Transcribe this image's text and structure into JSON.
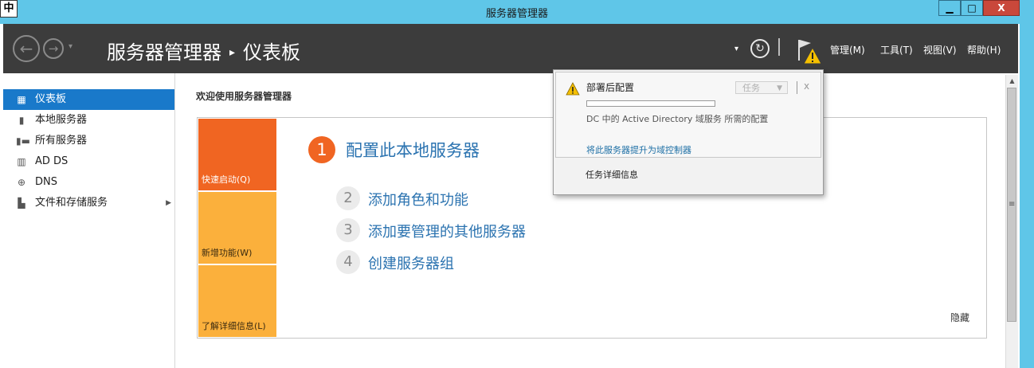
{
  "window": {
    "ime_label": "中",
    "title": "服务器管理器",
    "min_label": "▁",
    "max_label": "□",
    "close_label": "X"
  },
  "header": {
    "back_label": "←",
    "forward_label": "→",
    "nav_drop": "▾",
    "breadcrumb_root": "服务器管理器",
    "breadcrumb_sep": "▸",
    "breadcrumb_current": "仪表板",
    "refresh_label": "↻",
    "dropdown_label": "▾",
    "menus": [
      "管理(M)",
      "工具(T)",
      "视图(V)",
      "帮助(H)"
    ]
  },
  "sidebar": {
    "items": [
      {
        "label": "仪表板",
        "icon": "dashboard-icon"
      },
      {
        "label": "本地服务器",
        "icon": "local-server-icon"
      },
      {
        "label": "所有服务器",
        "icon": "all-servers-icon"
      },
      {
        "label": "AD DS",
        "icon": "ad-ds-icon"
      },
      {
        "label": "DNS",
        "icon": "dns-icon"
      },
      {
        "label": "文件和存储服务",
        "icon": "file-storage-icon",
        "arrow": "▶"
      }
    ]
  },
  "main": {
    "welcome": "欢迎使用服务器管理器",
    "tiles": [
      "快速启动(Q)",
      "新增功能(W)",
      "了解详细信息(L)"
    ],
    "steps": [
      {
        "num": "1",
        "label": "配置此本地服务器"
      },
      {
        "num": "2",
        "label": "添加角色和功能"
      },
      {
        "num": "3",
        "label": "添加要管理的其他服务器"
      },
      {
        "num": "4",
        "label": "创建服务器组"
      }
    ],
    "hide_label": "隐藏"
  },
  "scrollbar": {
    "up_label": "▲",
    "grip_label": "≡"
  },
  "notification": {
    "title": "部署后配置",
    "task_button": "任务",
    "task_arrow": "▼",
    "close_label": "x",
    "progress": 0,
    "description": "DC 中的 Active Directory 域服务 所需的配置",
    "link": "将此服务器提升为域控制器",
    "task_details": "任务详细信息"
  },
  "colors": {
    "titlebar": "#5fc6e8",
    "header": "#3c3c3c",
    "accent_orange": "#f06522",
    "tile_yellow": "#fbb03c",
    "link_blue": "#2b73b0",
    "sidebar_active": "#1979ca"
  }
}
